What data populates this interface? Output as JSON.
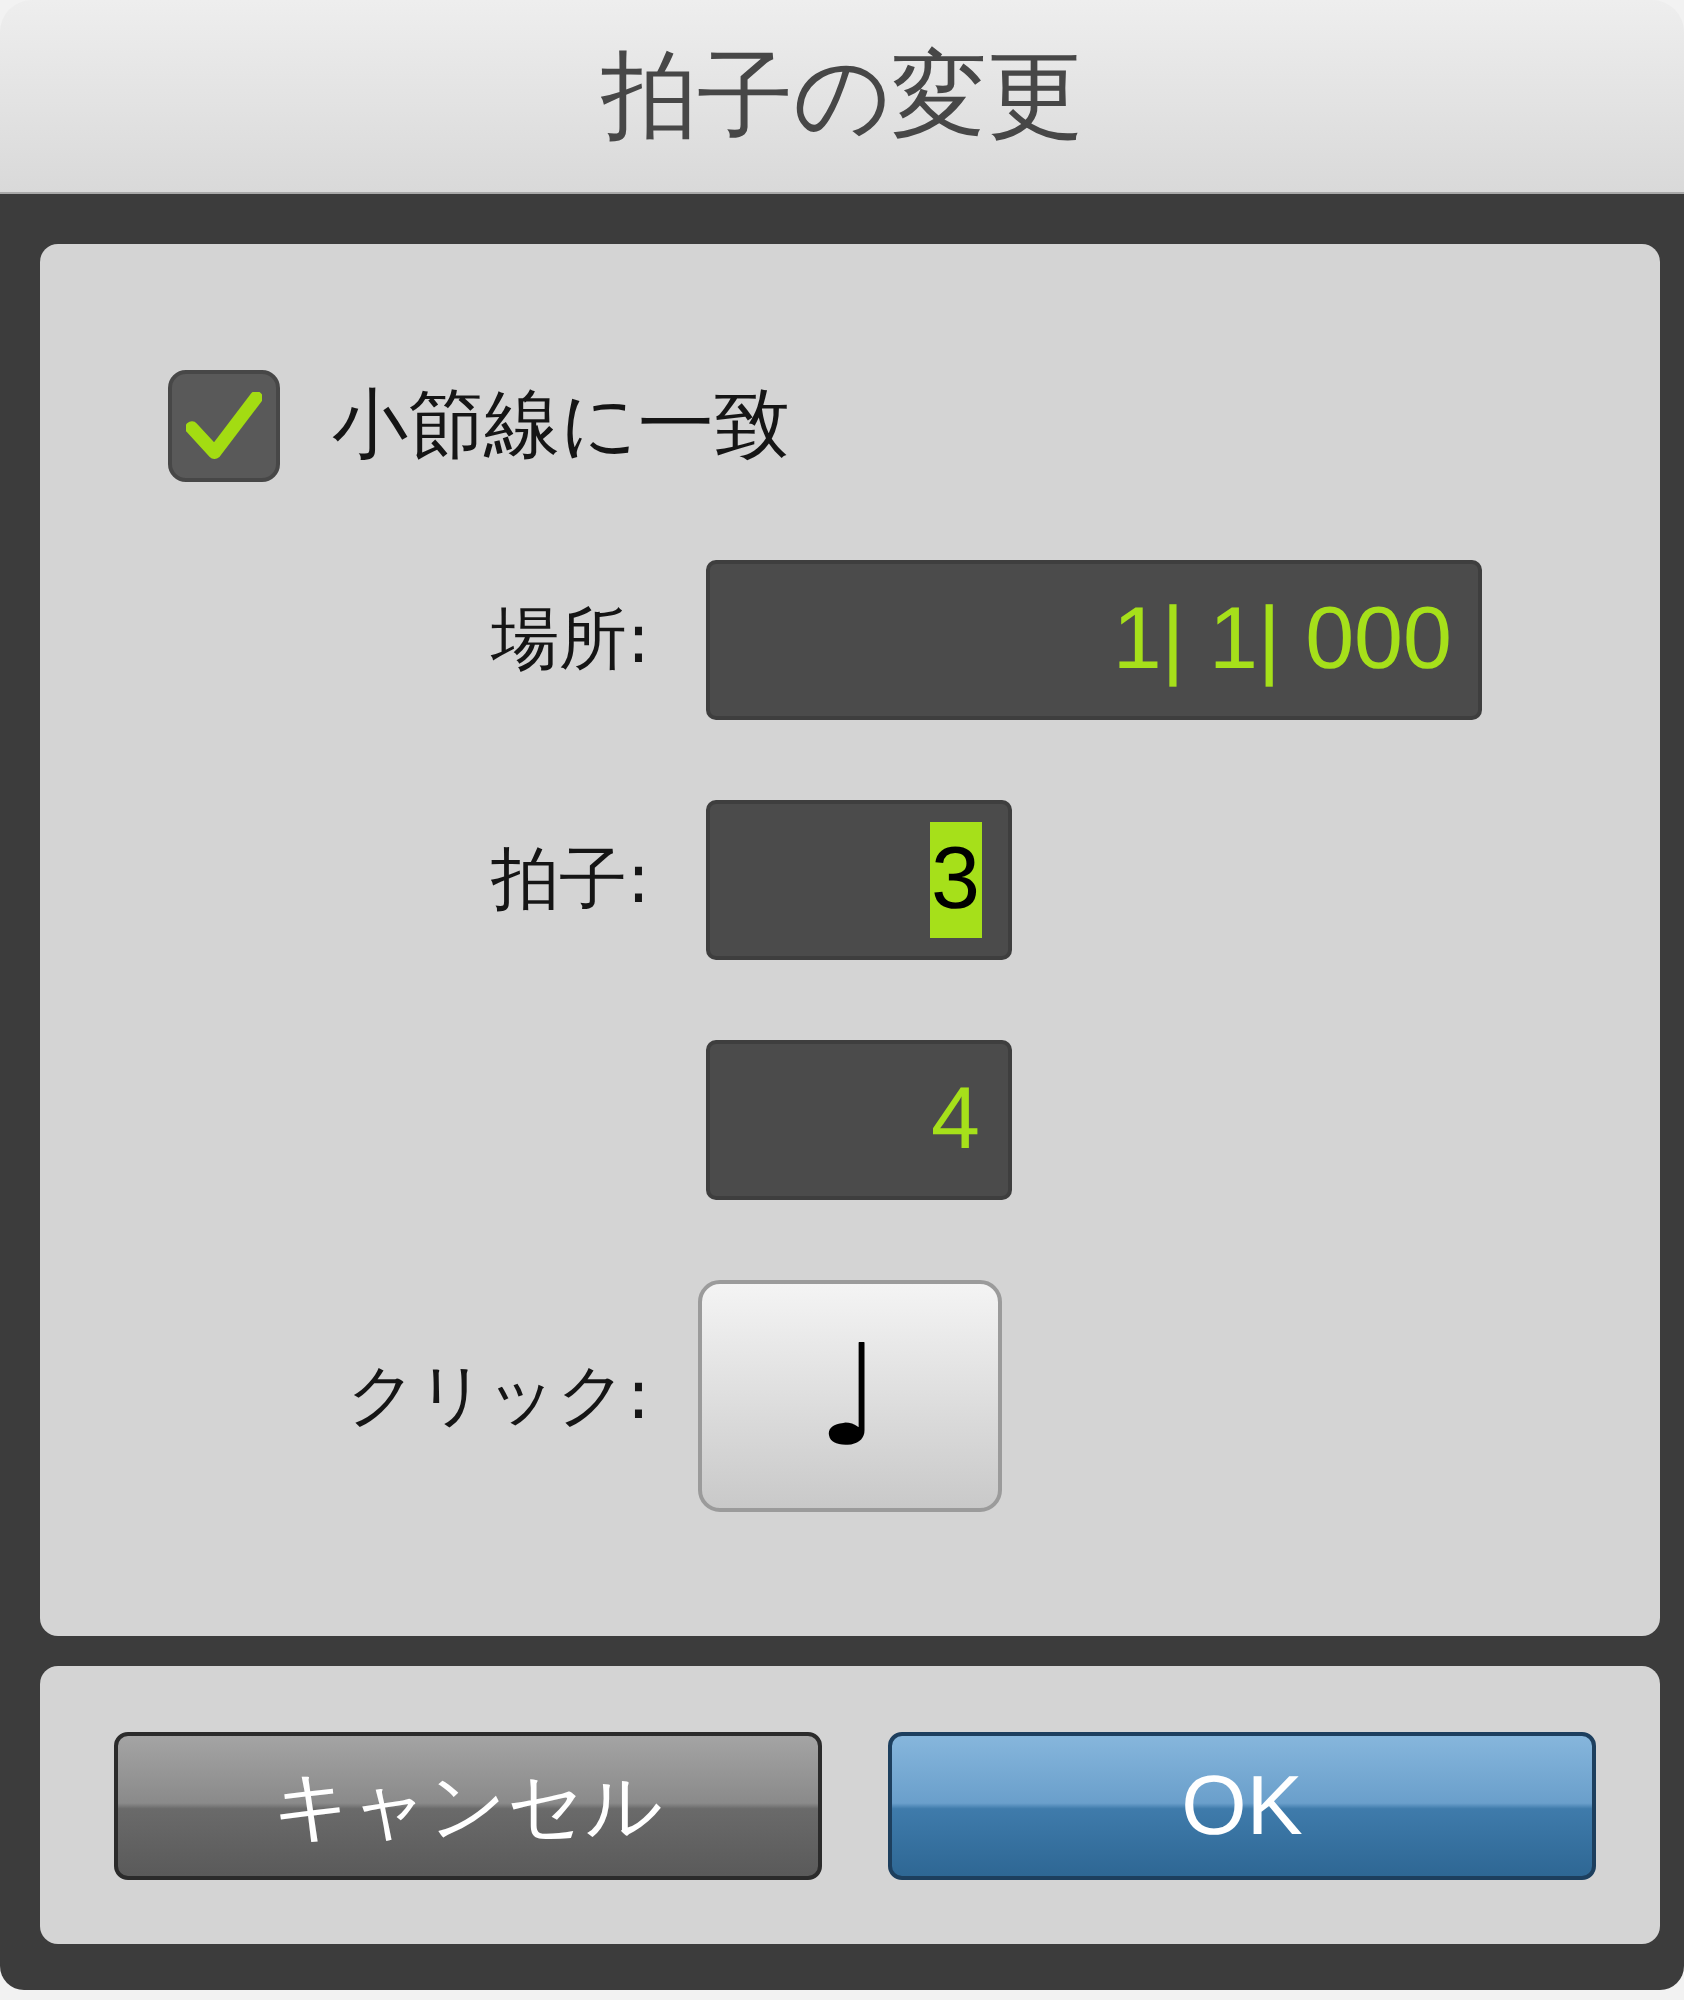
{
  "window": {
    "title": "拍子の変更"
  },
  "snap": {
    "label": "小節線に一致",
    "checked": true
  },
  "location": {
    "label": "場所:",
    "value": "1| 1| 000"
  },
  "meter": {
    "label": "拍子:",
    "fields": [
      {
        "value": "3",
        "highlighted": true
      },
      {
        "value": "4",
        "highlighted": false
      }
    ]
  },
  "click": {
    "label": "クリック:",
    "note": "♩"
  },
  "buttons": [
    {
      "label": "キャンセル",
      "kind": "cancel"
    },
    {
      "label": "OK",
      "kind": "default"
    }
  ]
}
